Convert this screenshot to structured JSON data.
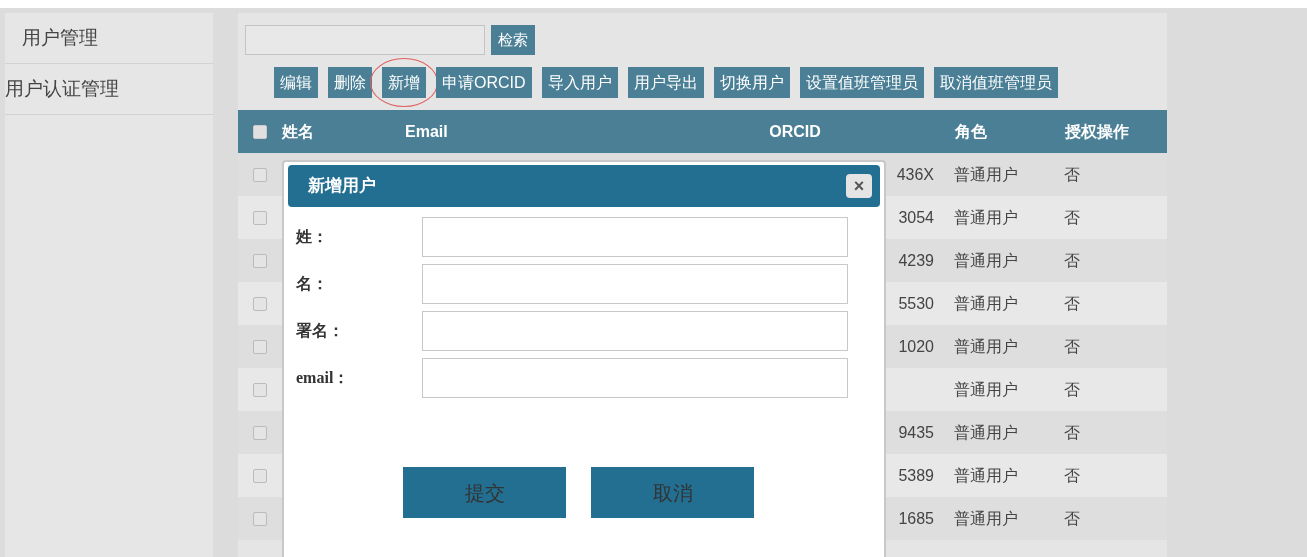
{
  "sidebar": {
    "items": [
      {
        "label": "用户管理",
        "selected": false
      },
      {
        "label": "用户认证管理",
        "selected": false
      }
    ]
  },
  "search": {
    "button": "检索"
  },
  "toolbar": [
    {
      "label": "编辑",
      "highlighted": false
    },
    {
      "label": "删除",
      "highlighted": false
    },
    {
      "label": "新增",
      "highlighted": true
    },
    {
      "label": "申请ORCID",
      "highlighted": false
    },
    {
      "label": "导入用户",
      "highlighted": false
    },
    {
      "label": "用户导出",
      "highlighted": false
    },
    {
      "label": "切换用户",
      "highlighted": false
    },
    {
      "label": "设置值班管理员",
      "highlighted": false
    },
    {
      "label": "取消值班管理员",
      "highlighted": false
    }
  ],
  "table": {
    "select_all_checked": false,
    "columns": [
      "姓名",
      "Email",
      "ORCID",
      "角色",
      "授权操作"
    ],
    "rows": [
      {
        "checked": false,
        "orcid": "436X",
        "role": "普通用户",
        "authorized": "否"
      },
      {
        "checked": false,
        "orcid": "3054",
        "role": "普通用户",
        "authorized": "否"
      },
      {
        "checked": false,
        "orcid": "4239",
        "role": "普通用户",
        "authorized": "否"
      },
      {
        "checked": false,
        "orcid": "5530",
        "role": "普通用户",
        "authorized": "否"
      },
      {
        "checked": false,
        "orcid": "1020",
        "role": "普通用户",
        "authorized": "否"
      },
      {
        "checked": false,
        "role": "普通用户",
        "authorized": "否"
      },
      {
        "checked": false,
        "orcid": "9435",
        "role": "普通用户",
        "authorized": "否"
      },
      {
        "checked": false,
        "orcid": "5389",
        "role": "普通用户",
        "authorized": "否"
      },
      {
        "checked": false,
        "orcid": "1685",
        "role": "普通用户",
        "authorized": "否"
      }
    ]
  },
  "dialog": {
    "title": "新增用户",
    "close": "×",
    "fields": [
      {
        "label": "姓："
      },
      {
        "label": "名："
      },
      {
        "label": "署名："
      },
      {
        "label": "email："
      }
    ],
    "buttons": [
      "提交",
      "取消"
    ]
  }
}
